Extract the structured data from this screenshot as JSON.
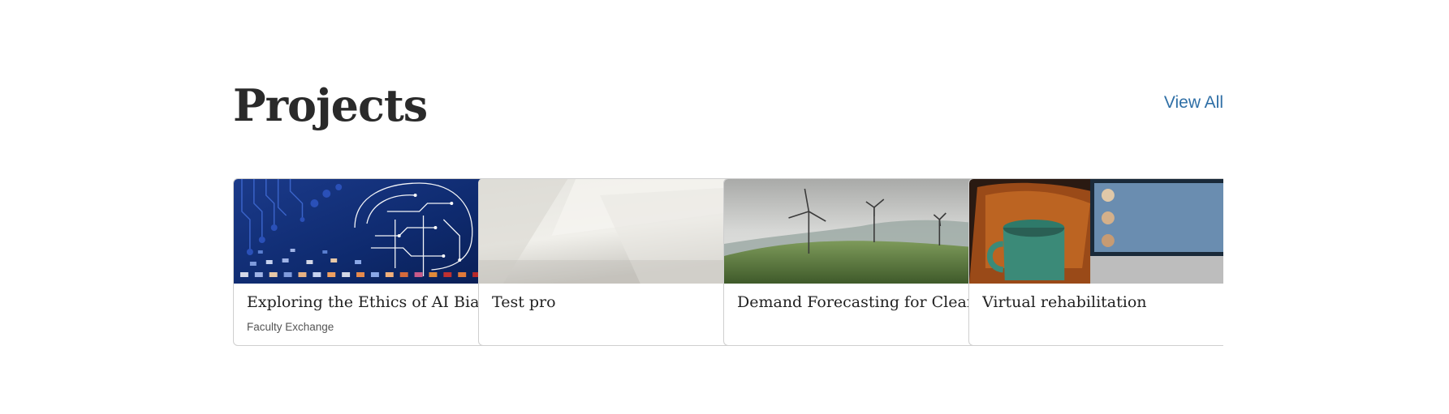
{
  "projects": {
    "title": "Projects",
    "view_all": "View All",
    "cards": [
      {
        "title": "Exploring the Ethics of AI Bias...",
        "subtitle": "Faculty Exchange",
        "image": "ai-circuit-brain"
      },
      {
        "title": "Test pro",
        "subtitle": "",
        "image": "abstract-grey"
      },
      {
        "title": "Demand Forecasting for Clean...",
        "subtitle": "",
        "image": "wind-turbines"
      },
      {
        "title": "Virtual rehabilitation",
        "subtitle": "",
        "image": "mug-video-call"
      }
    ]
  }
}
